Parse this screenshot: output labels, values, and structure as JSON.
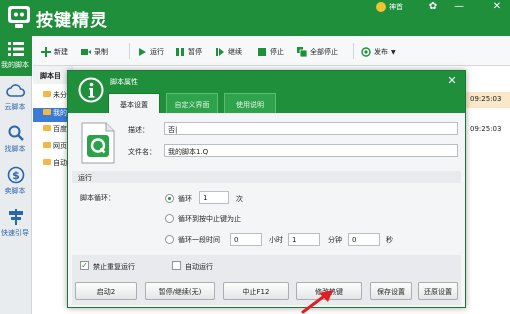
{
  "app": {
    "title": "按键精灵",
    "vip_label": "神首"
  },
  "colors": {
    "brand_green": "#1f8f3c",
    "selection_blue": "#3a7bd5",
    "arrow_red": "#e02020"
  },
  "sidebar": {
    "items": [
      {
        "label": "我的脚本",
        "icon": "list-icon"
      },
      {
        "label": "云脚本",
        "icon": "cloud-icon"
      },
      {
        "label": "找脚本",
        "icon": "search-icon"
      },
      {
        "label": "卖脚本",
        "icon": "dollar-icon"
      },
      {
        "label": "快速引导",
        "icon": "signpost-icon"
      }
    ]
  },
  "toolbar": {
    "new": "新建",
    "record": "录制",
    "run": "运行",
    "pause": "暂停",
    "resume": "继续",
    "stop": "停止",
    "stop_all": "全部停止",
    "publish": "发布"
  },
  "list": {
    "header": "脚本目",
    "folders": [
      "未分",
      "我的",
      "百度",
      "网页",
      "自动"
    ],
    "times": [
      "09:25:03",
      "09:25:03"
    ]
  },
  "dialog": {
    "title": "脚本属性",
    "tabs": [
      "基本设置",
      "自定义界面",
      "使用说明"
    ],
    "description_label": "描述：",
    "description_value": "否|",
    "filename_label": "文件名：",
    "filename_value": "我的脚本1.Q",
    "section_run": "运行",
    "loop_label": "脚本循环：",
    "loop_option1": "循环",
    "loop_count": "1",
    "loop_unit": "次",
    "loop_option2": "循环到按中止键为止",
    "loop_option3": "循环一段时间",
    "hours_value": "0",
    "hours_unit": "小时",
    "minutes_value": "1",
    "minutes_unit": "分钟",
    "seconds_value": "0",
    "seconds_unit": "秒",
    "forbid_repeat": "禁止重复运行",
    "auto_run": "自动运行",
    "buttons": [
      "启动2",
      "暂停/继续(无)",
      "中止F12",
      "修改热键",
      "保存设置",
      "还原设置"
    ]
  }
}
